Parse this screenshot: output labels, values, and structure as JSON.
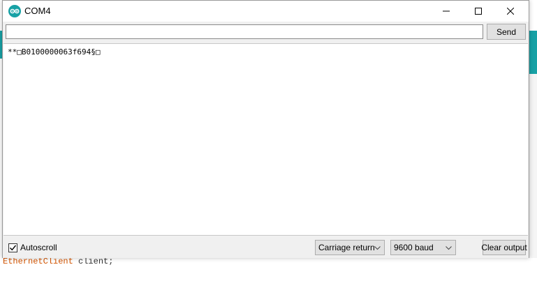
{
  "window": {
    "title": "COM4",
    "app_icon": "arduino-icon",
    "controls": [
      "minimize-icon",
      "maximize-icon",
      "close-icon"
    ]
  },
  "send_bar": {
    "input_value": "",
    "send_label": "Send"
  },
  "output": {
    "lines": [
      "**□B0100000063f694§□"
    ]
  },
  "footer": {
    "autoscroll_label": "Autoscroll",
    "autoscroll_checked": true,
    "line_ending": "Carriage return",
    "baud_rate": "9600 baud",
    "clear_label": "Clear output"
  },
  "background_editor": {
    "code_type": "EthernetClient",
    "code_rest": " client;"
  },
  "colors": {
    "arduino_teal": "#17a1a5",
    "keyword_orange": "#d35400"
  }
}
